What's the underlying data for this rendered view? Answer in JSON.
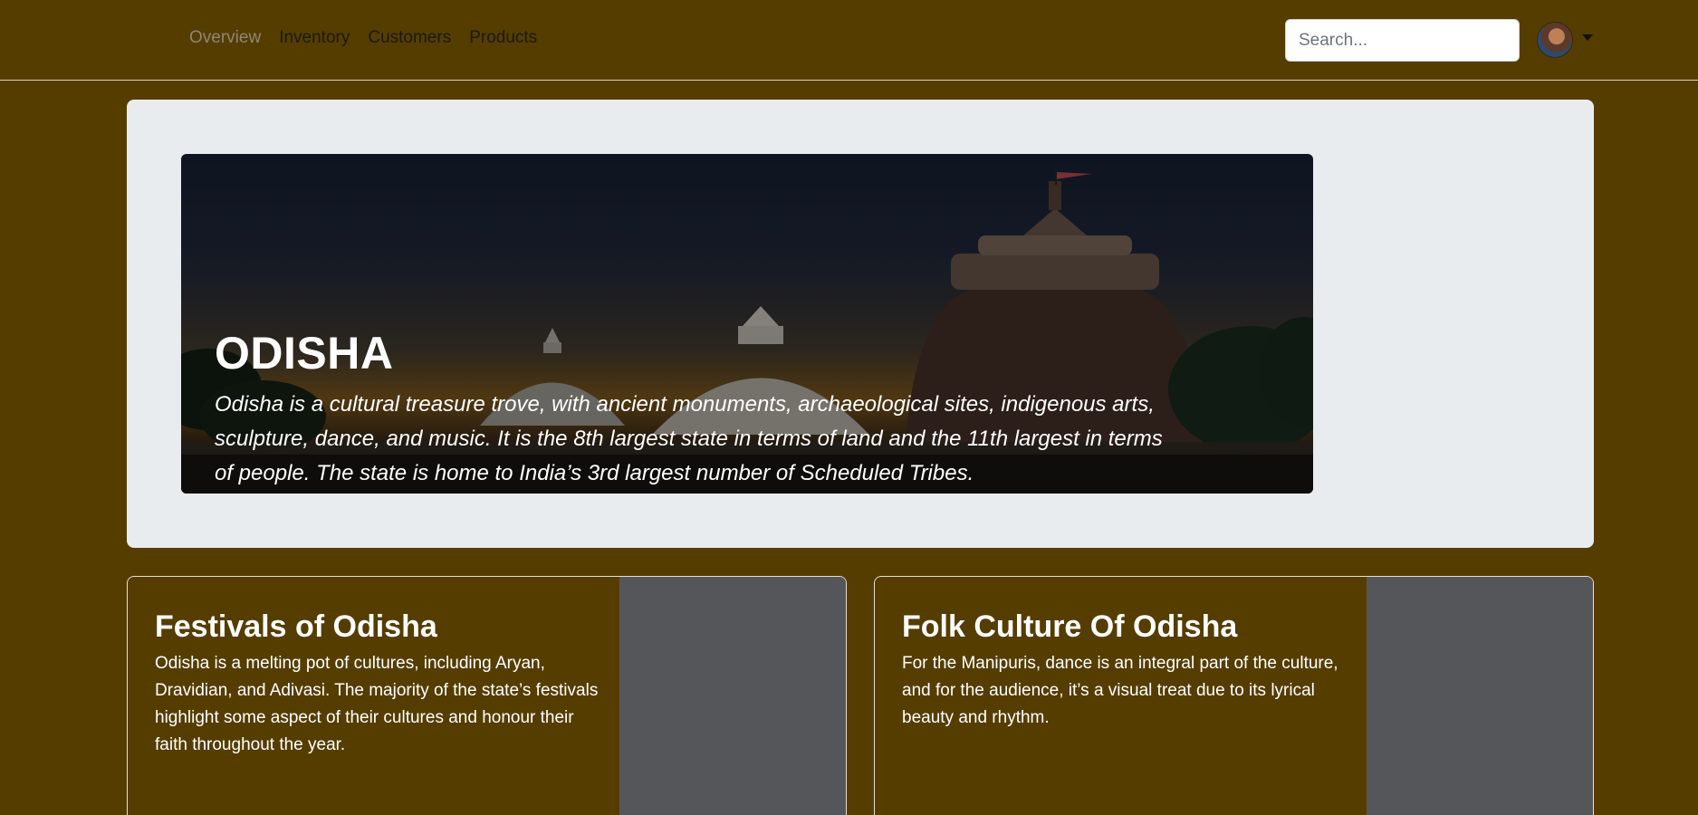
{
  "nav": {
    "links": [
      "Overview",
      "Inventory",
      "Customers",
      "Products"
    ],
    "active_index": 0
  },
  "search": {
    "placeholder": "Search..."
  },
  "user_menu": {
    "avatar_icon": "user-avatar",
    "caret_icon": "caret-down-icon"
  },
  "hero": {
    "title": "ODISHA",
    "description": "Odisha is a cultural treasure trove, with ancient monuments, archaeological sites, indigenous arts, sculpture, dance, and music. It is the 8th largest state in terms of land and the 11th largest in terms of people. The state is home to India’s 3rd largest number of Scheduled Tribes."
  },
  "cards": [
    {
      "title": "Festivals of Odisha",
      "text": "Odisha is a melting pot of cultures, including Aryan, Dravidian, and Adivasi. The majority of the state’s festivals highlight some aspect of their cultures and honour their faith throughout the year."
    },
    {
      "title": "Folk Culture Of Odisha",
      "text": "For the Manipuris, dance is an integral part of the culture, and for the audience, it’s a visual treat due to its lyrical beauty and rhythm."
    }
  ],
  "colors": {
    "page_bg": "#553d00",
    "jumbotron_bg": "#e9ecef",
    "card_image_placeholder": "#54565a"
  }
}
